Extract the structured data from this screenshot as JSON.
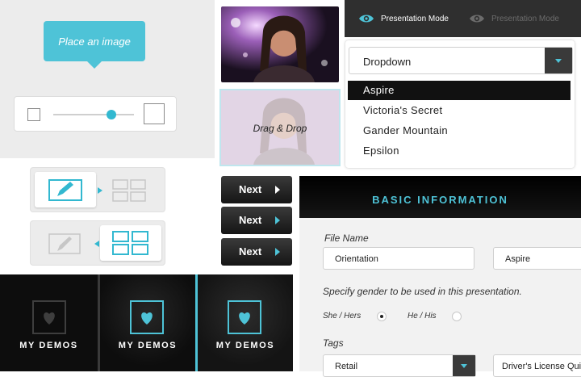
{
  "tooltip": {
    "text": "Place an image"
  },
  "slider": {
    "level": 0.72
  },
  "demos": [
    {
      "label": "MY DEMOS",
      "icon": "heart-icon",
      "state": "default"
    },
    {
      "label": "MY DEMOS",
      "icon": "heart-icon",
      "state": "hover"
    },
    {
      "label": "MY DEMOS",
      "icon": "heart-icon",
      "state": "active"
    }
  ],
  "drag_drop": {
    "label": "Drag & Drop"
  },
  "next_buttons": [
    {
      "label": "Next",
      "arrow_color": "#ffffff"
    },
    {
      "label": "Next",
      "arrow_color": "#4ec3d7"
    },
    {
      "label": "Next",
      "arrow_color": "#4ec3d7"
    }
  ],
  "presentation_bar": {
    "items": [
      {
        "label": "Presentation Mode",
        "icon": "eye-icon",
        "active": true
      },
      {
        "label": "Presentation Mode",
        "icon": "eye-icon",
        "active": false
      }
    ]
  },
  "dropdown": {
    "selected_label": "Dropdown",
    "options": [
      "Aspire",
      "Victoria's Secret",
      "Gander Mountain",
      "Epsilon"
    ],
    "highlighted_index": 0
  },
  "form": {
    "title": "BASIC INFORMATION",
    "file_name_label": "File Name",
    "file_name_value": "Orientation",
    "client_value": "Aspire",
    "gender_prompt": "Specify gender to be used in this presentation.",
    "gender_options": [
      {
        "label": "She / Hers",
        "selected": true
      },
      {
        "label": "He / His",
        "selected": false
      }
    ],
    "tags_label": "Tags",
    "tags_value": "Retail",
    "tag_right_value": "Driver's License Quick"
  },
  "colors": {
    "accent": "#4ec3d7",
    "dark": "#111111",
    "panel_gray": "#ececec"
  }
}
